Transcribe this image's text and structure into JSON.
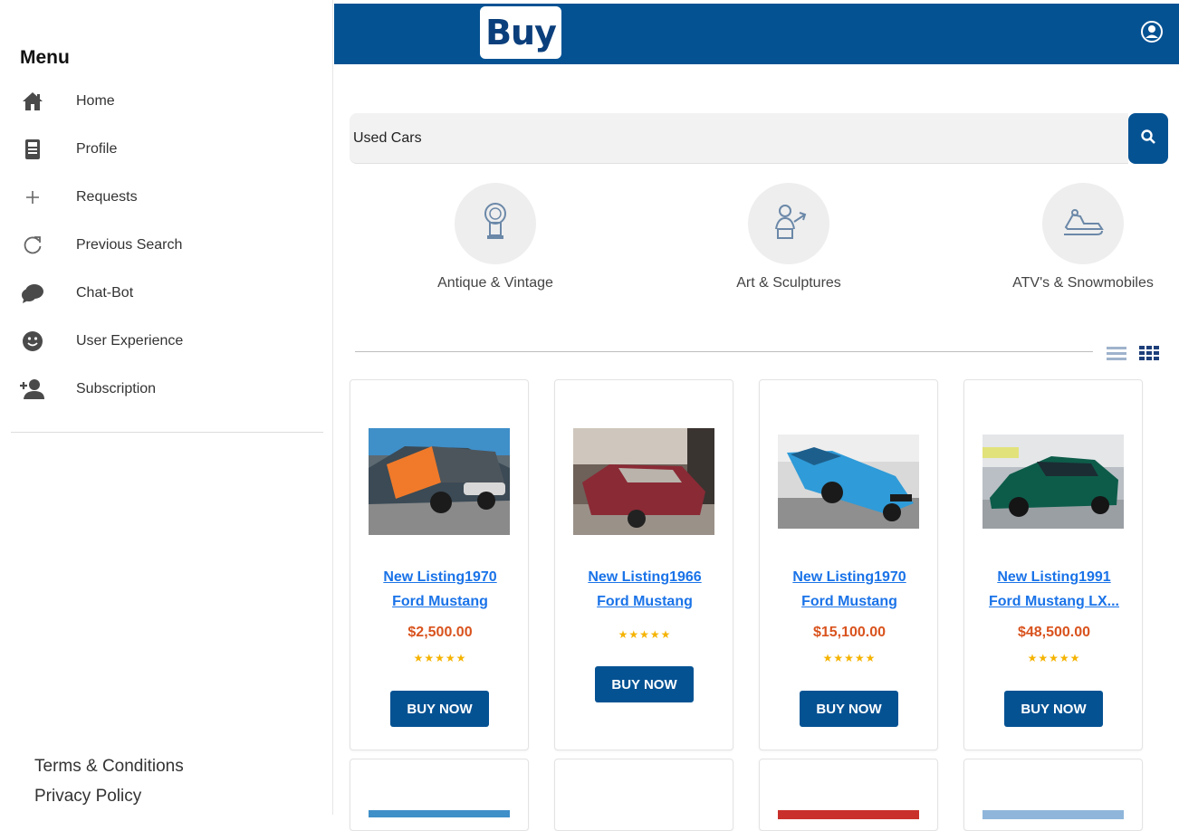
{
  "brand": {
    "logo_text_b": "Bu",
    "logo_text_y": "y",
    "header_color": "#055293"
  },
  "sidebar": {
    "title": "Menu",
    "items": [
      {
        "label": "Home",
        "icon": "home-icon"
      },
      {
        "label": "Profile",
        "icon": "profile-icon"
      },
      {
        "label": "Requests",
        "icon": "plus-icon"
      },
      {
        "label": "Previous Search",
        "icon": "refresh-icon"
      },
      {
        "label": "Chat-Bot",
        "icon": "chat-icon"
      },
      {
        "label": "User Experience",
        "icon": "smile-icon"
      },
      {
        "label": "Subscription",
        "icon": "add-user-icon"
      }
    ],
    "footer": {
      "terms": "Terms & Conditions",
      "privacy": "Privacy Policy"
    }
  },
  "search": {
    "value": "Used Cars"
  },
  "categories": [
    {
      "label": "Antique & Vintage",
      "icon": "clock-icon"
    },
    {
      "label": "Art & Sculptures",
      "icon": "sculpture-icon"
    },
    {
      "label": "ATV's & Snowmobiles",
      "icon": "snowmobile-icon"
    }
  ],
  "products": [
    {
      "title_line1": "New Listing1970",
      "title_line2": "Ford Mustang",
      "price": "$2,500.00",
      "stars": "★★★★★",
      "button": "BUY NOW"
    },
    {
      "title_line1": "New Listing1966",
      "title_line2": "Ford Mustang",
      "price": "",
      "stars": "★★★★★",
      "button": "BUY NOW"
    },
    {
      "title_line1": "New Listing1970",
      "title_line2": "Ford Mustang",
      "price": "$15,100.00",
      "stars": "★★★★★",
      "button": "BUY NOW"
    },
    {
      "title_line1": "New Listing1991",
      "title_line2": "Ford Mustang LX...",
      "price": "$48,500.00",
      "stars": "★★★★★",
      "button": "BUY NOW"
    }
  ],
  "colors": {
    "accent": "#055293",
    "price": "#d9531e",
    "link": "#1a73e8",
    "star": "#f5b301"
  }
}
